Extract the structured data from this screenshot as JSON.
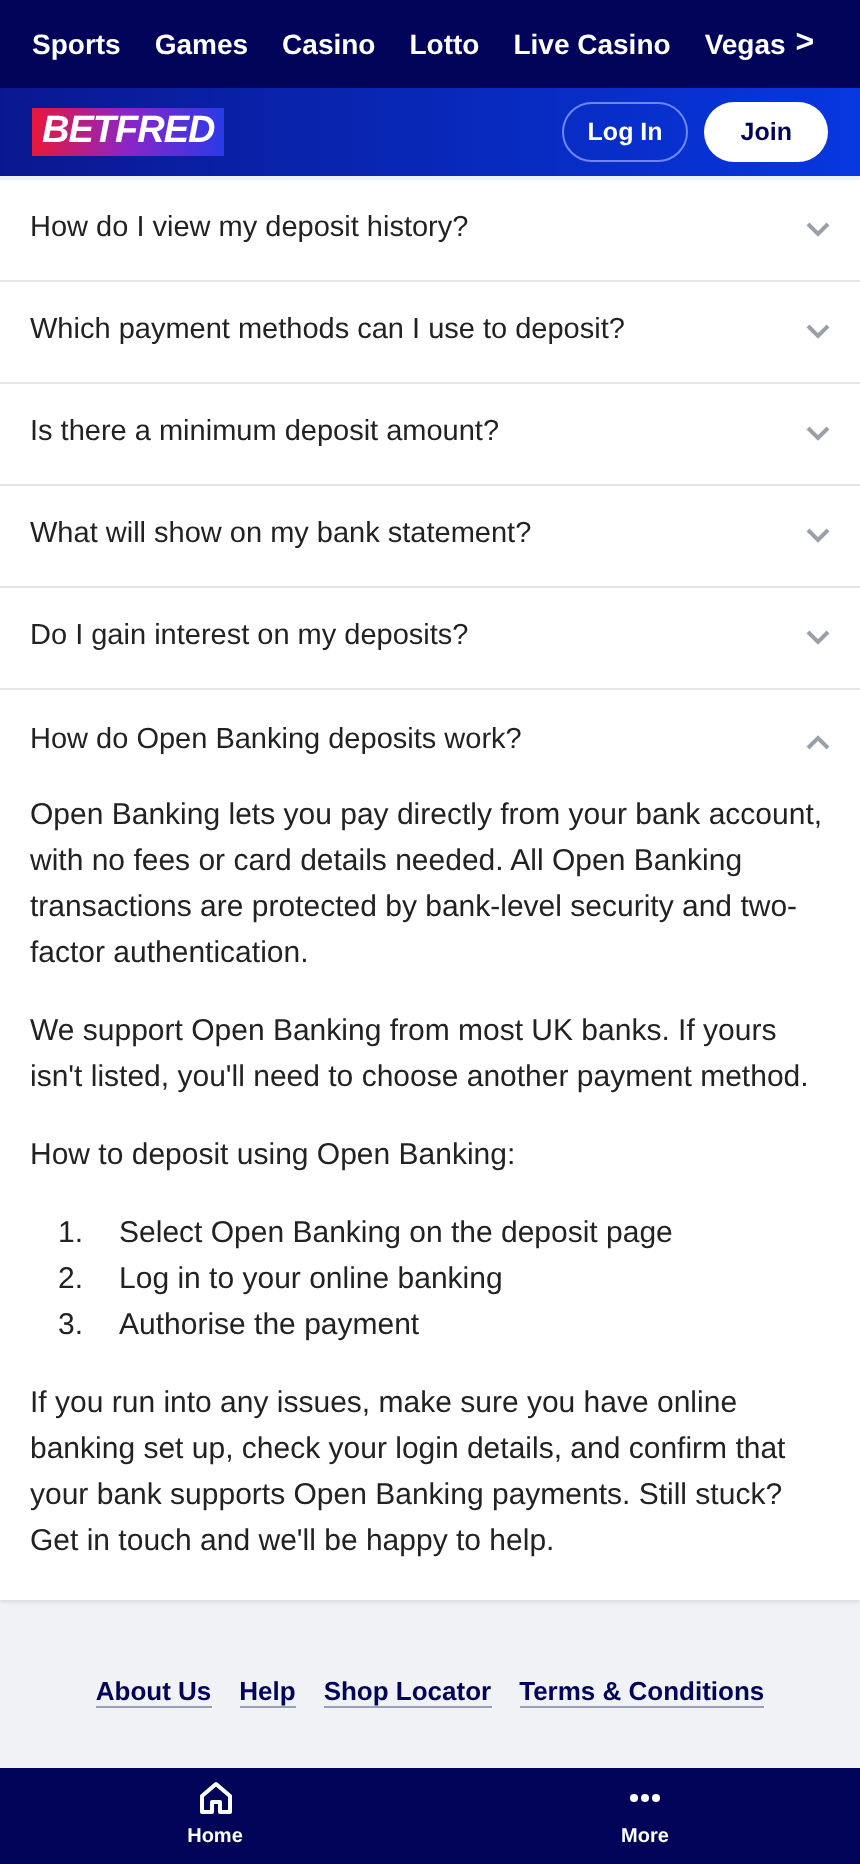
{
  "top_nav": {
    "items": [
      "Sports",
      "Games",
      "Casino",
      "Lotto",
      "Live Casino",
      "Vegas"
    ],
    "more": ">"
  },
  "header": {
    "logo": "BETFRED",
    "login": "Log In",
    "join": "Join"
  },
  "faq": [
    {
      "question": "How do I view my deposit history?",
      "expanded": false
    },
    {
      "question": "Which payment methods can I use to deposit?",
      "expanded": false
    },
    {
      "question": "Is there a minimum deposit amount?",
      "expanded": false
    },
    {
      "question": "What will show on my bank statement?",
      "expanded": false
    },
    {
      "question": "Do I gain interest on my deposits?",
      "expanded": false
    },
    {
      "question": "How do Open Banking deposits work?",
      "expanded": true,
      "answer": [
        {
          "kind": "paragraph",
          "text": "Open Banking lets you pay directly from your bank account, with no fees or card details needed. All Open Banking transactions are protected by bank-level security and two-factor authentication."
        },
        {
          "kind": "paragraph",
          "text": "We support Open Banking from most UK banks. If yours isn't listed, you'll need to choose another payment method."
        },
        {
          "kind": "paragraph",
          "text": "How to deposit using Open Banking:"
        },
        {
          "kind": "list",
          "items": [
            {
              "number": "1.",
              "text": "Select Open Banking on the deposit page"
            },
            {
              "number": "2.",
              "text": "Log in to your online banking"
            },
            {
              "number": "3.",
              "text": "Authorise the payment"
            }
          ]
        },
        {
          "kind": "paragraph",
          "text": "If you run into any issues, make sure you have online banking set up, check your login details, and confirm that your bank supports Open Banking payments. Still stuck? Get in touch and we'll be happy to help."
        }
      ]
    }
  ],
  "footer_links": [
    "About Us",
    "Help",
    "Shop Locator",
    "Terms & Conditions"
  ],
  "bottom_nav": [
    {
      "kind": "home",
      "label": "Home"
    },
    {
      "kind": "more",
      "label": "More"
    }
  ]
}
